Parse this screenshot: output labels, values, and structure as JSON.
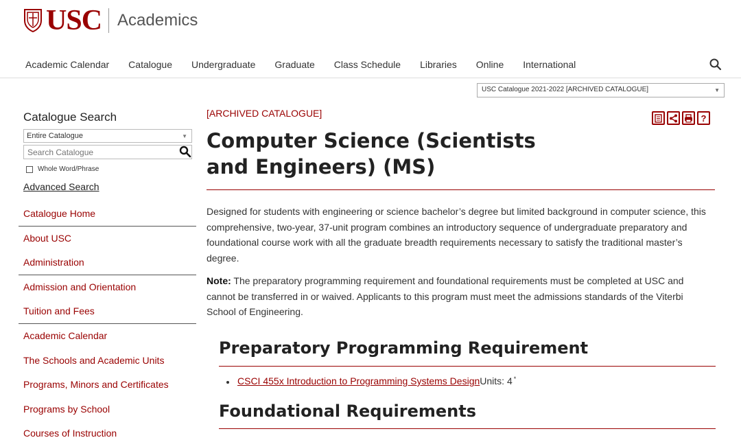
{
  "header": {
    "logo_text": "USC",
    "site_name": "Academics",
    "brand_color": "#990000"
  },
  "topnav": {
    "items": [
      "Academic Calendar",
      "Catalogue",
      "Undergraduate",
      "Graduate",
      "Class Schedule",
      "Libraries",
      "Online",
      "International"
    ],
    "search_icon": "search-icon"
  },
  "catalogue_select": {
    "value": "USC Catalogue 2021-2022 [ARCHIVED CATALOGUE]"
  },
  "sidebar": {
    "title": "Catalogue Search",
    "scope_value": "Entire Catalogue",
    "search_placeholder": "Search Catalogue",
    "whole_word_label": "Whole Word/Phrase",
    "advanced_search": "Advanced Search",
    "nav": [
      "Catalogue Home",
      "About USC",
      "Administration",
      "Admission and Orientation",
      "Tuition and Fees",
      "Academic Calendar",
      "The Schools and Academic Units",
      "Programs, Minors and Certificates",
      "Programs by School",
      "Courses of Instruction"
    ]
  },
  "main": {
    "archived_label": "[ARCHIVED CATALOGUE]",
    "title": "Computer Science (Scientists and Engineers) (MS)",
    "intro": "Designed for students with engineering or science bachelor’s degree but limited background in computer science, this comprehensive, two-year, 37-unit program combines an introductory sequence of undergraduate preparatory and foundational course work with all the graduate breadth requirements necessary to satisfy the traditional master’s degree.",
    "note_label": "Note:",
    "note_text": " The preparatory programming requirement and foundational requirements must be completed at USC and cannot be transferred in or waived. Applicants to this program must meet the admissions standards of the Viterbi School of Engineering.",
    "section1_title": "Preparatory Programming Requirement",
    "course1_link": "CSCI 455x Introduction to Programming Systems Design ",
    "course1_units": "Units: 4",
    "course1_sup": "*",
    "section2_title": "Foundational Requirements"
  }
}
